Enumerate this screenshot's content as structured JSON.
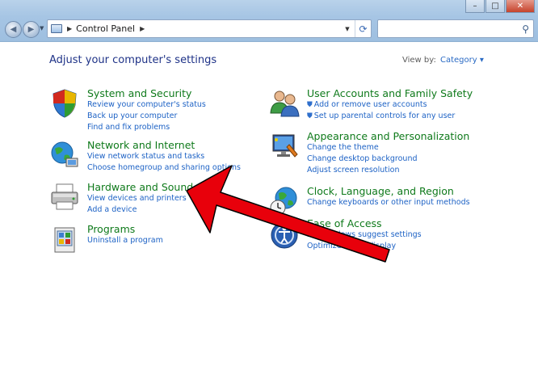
{
  "window": {
    "minimize_glyph": "–",
    "maximize_glyph": "□",
    "close_glyph": "✕"
  },
  "navigation": {
    "back_glyph": "◀",
    "forward_glyph": "▶",
    "dropdown_glyph": "▼"
  },
  "addressbar": {
    "root_arrow": "▶",
    "breadcrumb": "Control Panel",
    "crumb_arrow": "▶",
    "dropdown_glyph": "▼",
    "refresh_glyph": "⟳"
  },
  "search": {
    "placeholder": "",
    "icon": "search-icon"
  },
  "page": {
    "heading": "Adjust your computer's settings",
    "view_by_label": "View by:",
    "view_by_value": "Category ▾"
  },
  "categories_left": [
    {
      "title": "System and Security",
      "icon": "shield-icon",
      "links": [
        "Review your computer's status",
        "Back up your computer",
        "Find and fix problems"
      ]
    },
    {
      "title": "Network and Internet",
      "icon": "globe-network-icon",
      "links": [
        "View network status and tasks",
        "Choose homegroup and sharing options"
      ]
    },
    {
      "title": "Hardware and Sound",
      "icon": "printer-icon",
      "links": [
        "View devices and printers",
        "Add a device"
      ]
    },
    {
      "title": "Programs",
      "icon": "programs-icon",
      "links": [
        "Uninstall a program"
      ]
    }
  ],
  "categories_right": [
    {
      "title": "User Accounts and Family Safety",
      "icon": "users-icon",
      "links": [
        "Add or remove user accounts",
        "Set up parental controls for any user"
      ],
      "shielded": [
        true,
        true
      ]
    },
    {
      "title": "Appearance and Personalization",
      "icon": "monitor-paint-icon",
      "links": [
        "Change the theme",
        "Change desktop background",
        "Adjust screen resolution"
      ]
    },
    {
      "title": "Clock, Language, and Region",
      "icon": "clock-globe-icon",
      "links": [
        "Change keyboards or other input methods"
      ]
    },
    {
      "title": "Ease of Access",
      "icon": "ease-of-access-icon",
      "links": [
        "Let Windows suggest settings",
        "Optimize visual display"
      ]
    }
  ],
  "overlay": {
    "arrow_color": "#e8000b",
    "arrow_outline": "#000000"
  }
}
